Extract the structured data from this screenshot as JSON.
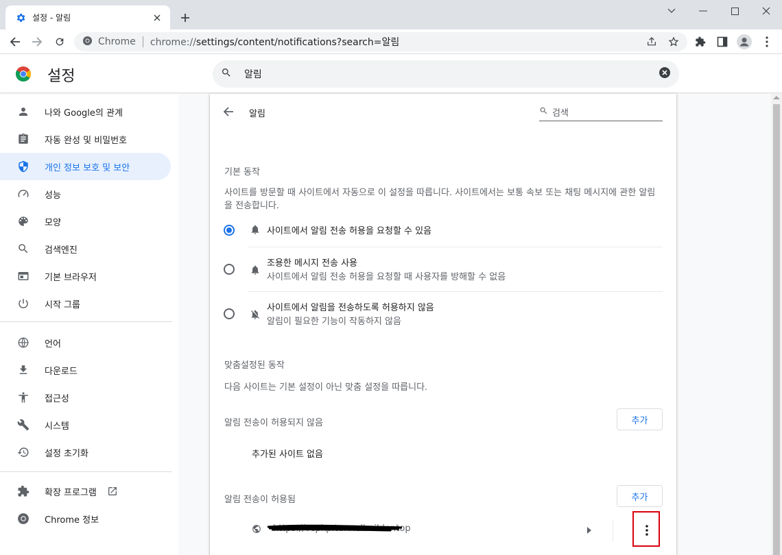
{
  "browser": {
    "tab_title": "설정 - 알림",
    "site_chip": "Chrome",
    "url_prefix": "chrome://",
    "url_rest": "settings/content/notifications?search=알림"
  },
  "header": {
    "title": "설정",
    "search_value": "알림"
  },
  "sidebar": {
    "items": [
      {
        "label": "나와 Google의 관계",
        "icon": "person-icon"
      },
      {
        "label": "자동 완성 및 비밀번호",
        "icon": "clipboard-icon"
      },
      {
        "label": "개인 정보 보호 및 보안",
        "icon": "shield-icon",
        "active": true
      },
      {
        "label": "성능",
        "icon": "speedometer-icon"
      },
      {
        "label": "모양",
        "icon": "palette-icon"
      },
      {
        "label": "검색엔진",
        "icon": "search-icon"
      },
      {
        "label": "기본 브라우저",
        "icon": "browser-icon"
      },
      {
        "label": "시작 그룹",
        "icon": "power-icon"
      },
      {
        "label": "언어",
        "icon": "globe-icon"
      },
      {
        "label": "다운로드",
        "icon": "download-icon"
      },
      {
        "label": "접근성",
        "icon": "accessibility-icon"
      },
      {
        "label": "시스템",
        "icon": "wrench-icon"
      },
      {
        "label": "설정 초기화",
        "icon": "history-icon"
      },
      {
        "label": "확장 프로그램",
        "icon": "extension-icon"
      },
      {
        "label": "Chrome 정보",
        "icon": "chrome-icon"
      }
    ]
  },
  "main": {
    "page_title": "알림",
    "search_placeholder": "검색",
    "default_behavior_heading": "기본 동작",
    "default_behavior_desc": "사이트를 방문할 때 사이트에서 자동으로 이 설정을 따릅니다. 사이트에서는 보통 속보 또는 채팅 메시지에 관한 알림을 전송합니다.",
    "options": [
      {
        "label": "사이트에서 알림 전송 허용을 요청할 수 있음",
        "sub": "",
        "checked": true
      },
      {
        "label": "조용한 메시지 전송 사용",
        "sub": "사이트에서 알림 전송 허용을 요청할 때 사용자를 방해할 수 없음",
        "checked": false
      },
      {
        "label": "사이트에서 알림을 전송하도록 허용하지 않음",
        "sub": "알림이 필요한 기능이 작동하지 않음",
        "checked": false
      }
    ],
    "custom_heading": "맞춤설정된 동작",
    "custom_desc": "다음 사이트는 기본 설정이 아닌 맞춤 설정을 따릅니다.",
    "blocked_heading": "알림 전송이 허용되지 않음",
    "add_label": "추가",
    "no_sites": "추가된 사이트 없음",
    "allowed_heading": "알림 전송이 허용됨",
    "allowed_site": "https://vcpkp.tunnelbuilder.top"
  }
}
